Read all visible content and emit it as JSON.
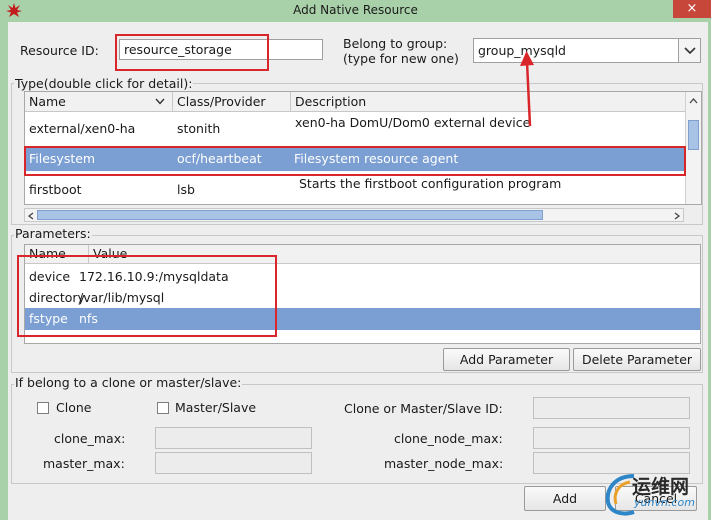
{
  "window": {
    "title": "Add Native Resource",
    "close_glyph": "×"
  },
  "resource_id": {
    "label": "Resource ID:",
    "value": "resource_storage"
  },
  "group": {
    "label_line1": "Belong to group:",
    "label_line2": "(type for new one)",
    "value": "group_mysqld"
  },
  "type_section": {
    "title": "Type(double click for detail):",
    "columns": [
      "Name",
      "Class/Provider",
      "Description"
    ],
    "rows": [
      {
        "name": "external/xen0-ha",
        "provider": "stonith",
        "description": "xen0-ha DomU/Dom0 external device"
      },
      {
        "name": "Filesystem",
        "provider": "ocf/heartbeat",
        "description": "Filesystem resource agent"
      },
      {
        "name": "firstboot",
        "provider": "lsb",
        "description": "Starts the firstboot configuration program"
      }
    ],
    "selected_row": 1
  },
  "parameters": {
    "title": "Parameters:",
    "columns": [
      "Name",
      "Value"
    ],
    "rows": [
      {
        "name": "device",
        "value": "172.16.10.9:/mysqldata"
      },
      {
        "name": "directory",
        "value": "/var/lib/mysql"
      },
      {
        "name": "fstype",
        "value": "nfs"
      }
    ],
    "selected_row": 2,
    "add_button": "Add Parameter",
    "delete_button": "Delete Parameter"
  },
  "clone_section": {
    "title": "If belong to a clone or master/slave:",
    "clone_label": "Clone",
    "master_slave_label": "Master/Slave",
    "clone_id_label": "Clone or Master/Slave ID:",
    "clone_max_label": "clone_max:",
    "clone_node_max_label": "clone_node_max:",
    "master_max_label": "master_max:",
    "master_node_max_label": "master_node_max:"
  },
  "buttons": {
    "add": "Add",
    "cancel": "Cancel"
  },
  "watermark": {
    "chinese": "运维网",
    "site": "yunvn.com"
  },
  "colors": {
    "annotation": "#d9262b",
    "selection": "#7b9fd3",
    "titlebar": "#a9d1a9"
  }
}
